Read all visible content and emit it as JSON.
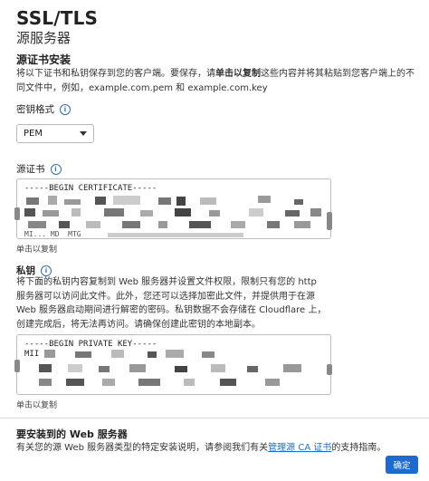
{
  "header": {
    "title": "SSL/TLS",
    "subtitle": "源服务器"
  },
  "install": {
    "heading": "源证书安装",
    "desc_part1": "将以下证书和私钥保存到您的客户端。要保存，请",
    "desc_bold": "单击以复制",
    "desc_part2": "这些内容并将其粘贴到您客户端上的不同文件中，例如，example.com.pem 和 example.com.key"
  },
  "key_format": {
    "label": "密钥格式",
    "selected": "PEM"
  },
  "certificate": {
    "label": "源证书",
    "line1": "-----BEGIN CERTIFICATE-----",
    "line_last": "MI... MD  MTG",
    "copy_hint": "单击以复制"
  },
  "private_key": {
    "label": "私钥",
    "desc": "将下面的私钥内容复制到 Web 服务器并设置文件权限，限制只有您的 http 服务器可以访问此文件。此外，您还可以选择加密此文件，并提供用于在源 Web 服务器启动期间进行解密的密码。私钥数据不会存储在 Cloudflare 上，创建完成后，将无法再访问。请确保创建此密钥的本地副本。",
    "line1": "-----BEGIN PRIVATE KEY-----",
    "line2": "MII",
    "copy_hint": "单击以复制"
  },
  "server": {
    "heading": "要安装到的 Web 服务器",
    "desc_part1": "有关您的源 Web 服务器类型的特定安装说明，请参阅我们有关",
    "link": "管理源 CA 证书",
    "desc_part2": "的支持指南。"
  },
  "confirm_label": "确定",
  "colors": {
    "accent": "#1d6bd1",
    "link": "#1f6fc2",
    "info": "#2f6fb2"
  }
}
